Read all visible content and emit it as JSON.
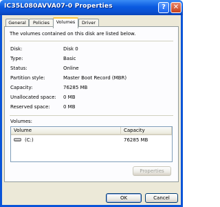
{
  "window": {
    "title": "IC35L080AVVA07-0 Properties",
    "help_glyph": "?",
    "close_glyph": "✕"
  },
  "tabs": [
    {
      "label": "General",
      "active": false
    },
    {
      "label": "Policies",
      "active": false
    },
    {
      "label": "Volumes",
      "active": true
    },
    {
      "label": "Driver",
      "active": false
    }
  ],
  "panel": {
    "intro": "The volumes contained on this disk are listed below.",
    "properties": [
      {
        "label": "Disk:",
        "value": "Disk 0"
      },
      {
        "label": "Type:",
        "value": "Basic"
      },
      {
        "label": "Status:",
        "value": "Online"
      },
      {
        "label": "Partition style:",
        "value": "Master Boot Record (MBR)"
      },
      {
        "label": "Capacity:",
        "value": "76285 MB"
      },
      {
        "label": "Unallocated space:",
        "value": "0 MB"
      },
      {
        "label": "Reserved space:",
        "value": "0 MB"
      }
    ],
    "volumes_label": "Volumes:",
    "columns": [
      "Volume",
      "Capacity"
    ],
    "rows": [
      {
        "volume": "(C:)",
        "capacity": "76285 MB",
        "icon": "drive-icon"
      }
    ],
    "properties_button": "Properties"
  },
  "buttons": {
    "ok": "OK",
    "cancel": "Cancel"
  },
  "colors": {
    "titlebar": "#0a54d8",
    "face": "#ece9d8",
    "tab_highlight": "#ffc73c"
  }
}
